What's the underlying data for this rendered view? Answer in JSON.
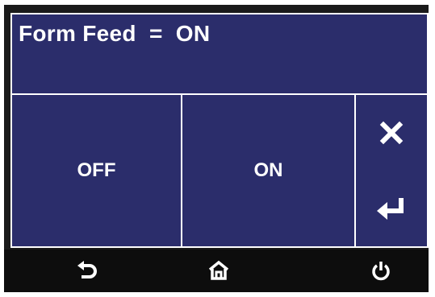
{
  "header": {
    "title": "Form Feed  =  ON"
  },
  "options": {
    "off_label": "OFF",
    "on_label": "ON"
  },
  "side": {
    "cancel_icon": "close-icon",
    "enter_icon": "enter-icon"
  },
  "footer": {
    "back_icon": "back-icon",
    "home_icon": "home-icon",
    "power_icon": "power-icon"
  },
  "colors": {
    "panel": "#2b2d6b",
    "text": "#ffffff",
    "frame": "#1a1a1a"
  }
}
